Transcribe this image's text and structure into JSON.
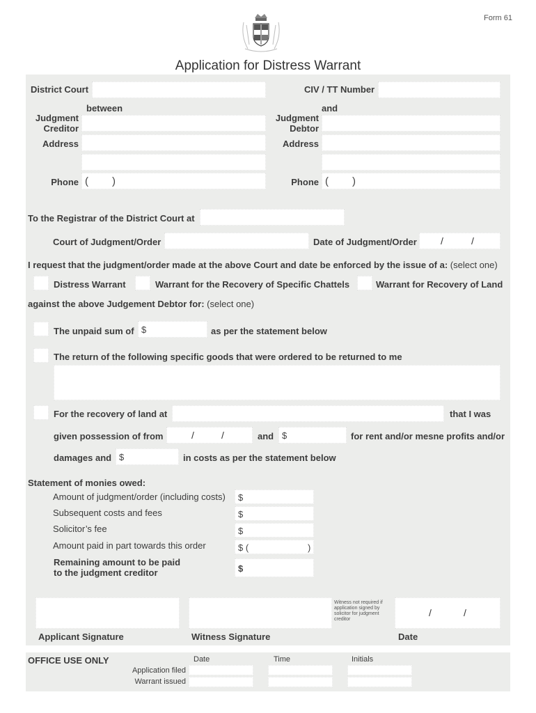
{
  "header": {
    "form_number": "Form 61",
    "title": "Application for Distress Warrant",
    "crest_icon": "coat-of-arms"
  },
  "parties": {
    "district_court_label": "District Court",
    "civ_tt_label": "CIV / TT Number",
    "between_label": "between",
    "and_label": "and",
    "creditor_label_line1": "Judgment",
    "creditor_label_line2": "Creditor",
    "debtor_label_line1": "Judgment",
    "debtor_label_line2": "Debtor",
    "address_label": "Address",
    "phone_label": "Phone",
    "phone_prefix": "(",
    "phone_suffix": ")"
  },
  "registrar": {
    "to_registrar_label": "To the Registrar of the District Court at",
    "court_of_judgment_label": "Court of Judgment/Order",
    "date_of_judgment_label": "Date of Judgment/Order",
    "date_separator": "/"
  },
  "request": {
    "request_text_bold": "I request that the judgment/order made at the above Court and date be enforced by the issue of a:",
    "select_one": "(select one)",
    "options": [
      {
        "label": "Distress Warrant",
        "checked": false
      },
      {
        "label": "Warrant for the Recovery of Specific Chattels",
        "checked": false
      },
      {
        "label": "Warrant for Recovery of Land",
        "checked": false
      }
    ],
    "against_text_bold": "against the above Judgement Debtor for:",
    "against_select_one": "(select one)"
  },
  "claims": {
    "unpaid_label": "The unpaid sum of",
    "currency": "$",
    "unpaid_suffix": "as per the statement below",
    "goods_label": "The return of the following specific goods that were ordered to be returned to me",
    "land_label": "For the recovery of land at",
    "land_suffix": "that I was",
    "possession_label": "given possession of from",
    "and_label": "and",
    "rent_label": "for rent and/or mesne profits and/or",
    "damages_label": "damages and",
    "costs_label": "in costs as per the statement below"
  },
  "statement": {
    "heading": "Statement of monies owed:",
    "rows": [
      {
        "label": "Amount of judgment/order (including costs)",
        "prefix": "$",
        "suffix": ""
      },
      {
        "label": "Subsequent costs and fees",
        "prefix": "$",
        "suffix": ""
      },
      {
        "label": "Solicitor’s fee",
        "prefix": "$",
        "suffix": ""
      },
      {
        "label": "Amount paid in part towards this order",
        "prefix": "$ (",
        "suffix": ")"
      }
    ],
    "remaining_line1": "Remaining amount to be paid",
    "remaining_line2": "to the judgment creditor",
    "remaining_prefix": "$"
  },
  "signatures": {
    "applicant_label": "Applicant Signature",
    "witness_label": "Witness Signature",
    "witness_note": "Witness not required if application signed by solicitor for judgment creditor",
    "date_label": "Date",
    "date_separator": "/"
  },
  "office": {
    "heading": "OFFICE USE ONLY",
    "columns": [
      "Date",
      "Time",
      "Initials"
    ],
    "rows": [
      "Application filed",
      "Warrant issued"
    ]
  },
  "colors": {
    "panel_bg": "#ecedeb",
    "field_bg": "#ffffff",
    "text": "#3c3c3c"
  }
}
